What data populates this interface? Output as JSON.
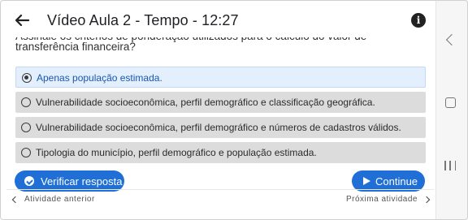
{
  "header": {
    "title": "Vídeo Aula 2 - Tempo - 12:27",
    "back_icon": "arrow-left-icon",
    "info_icon": "info-icon",
    "info_glyph": "i"
  },
  "question": {
    "text": "Assinale os critérios de ponderação utilizados para o cálculo do valor de transferência financeira?"
  },
  "options": [
    {
      "label": "Apenas população estimada.",
      "selected": true
    },
    {
      "label": "Vulnerabilidade socioeconômica, perfil demográfico e classificação geográfica.",
      "selected": false
    },
    {
      "label": "Vulnerabilidade socioeconômica, perfil demográfico e números de cadastros válidos.",
      "selected": false
    },
    {
      "label": "Tipologia do município, perfil demográfico e população estimada.",
      "selected": false
    }
  ],
  "actions": {
    "verify_label": "Verificar resposta",
    "verify_icon": "check-circle-icon",
    "continue_label": "Continue",
    "continue_icon": "play-icon"
  },
  "footer_nav": {
    "prev_label": "Atividade anterior",
    "next_label": "Próxima atividade"
  },
  "colors": {
    "primary": "#1f6fd6",
    "selected_bg": "#e3effd",
    "option_bg": "#dcdcdc"
  },
  "system_nav": {
    "back_icon": "system-back-icon",
    "home_icon": "system-home-icon",
    "recents_icon": "system-recents-icon"
  }
}
